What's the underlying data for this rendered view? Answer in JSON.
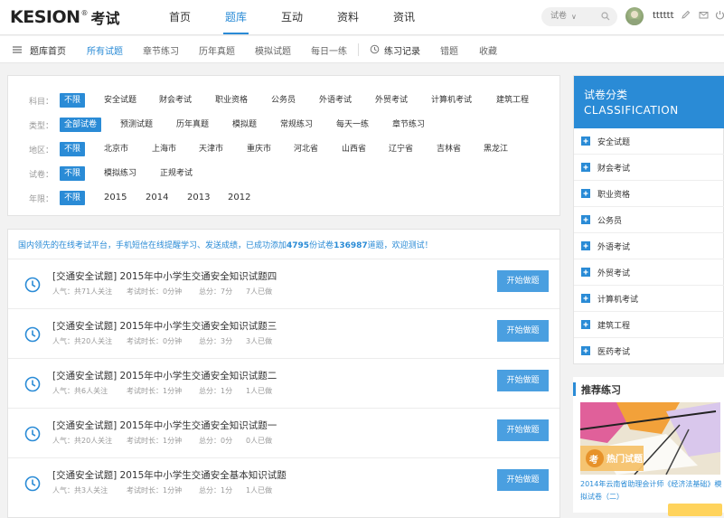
{
  "logo": {
    "en": "KESION",
    "reg": "®",
    "cn": "考试"
  },
  "nav": [
    "首页",
    "题库",
    "互动",
    "资料",
    "资讯"
  ],
  "nav_active": "题库",
  "search": {
    "label": "试卷",
    "arrow": "∨"
  },
  "user": {
    "name": "tttttt"
  },
  "subnav": {
    "home": "题库首页",
    "items": [
      "所有试题",
      "章节练习",
      "历年真题",
      "模拟试题",
      "每日一练"
    ],
    "practice": "练习记录",
    "wrong": "错题",
    "fav": "收藏"
  },
  "filters": {
    "subject": {
      "label": "科目：",
      "options": [
        "不限",
        "安全试题",
        "财会考试",
        "职业资格",
        "公务员",
        "外语考试",
        "外贸考试",
        "计算机考试",
        "建筑工程"
      ]
    },
    "type": {
      "label": "类型：",
      "options": [
        "全部试卷",
        "预测试题",
        "历年真题",
        "模拟题",
        "常规练习",
        "每天一练",
        "章节练习"
      ]
    },
    "region": {
      "label": "地区：",
      "options": [
        "不限",
        "北京市",
        "上海市",
        "天津市",
        "重庆市",
        "河北省",
        "山西省",
        "辽宁省",
        "吉林省",
        "黑龙江"
      ]
    },
    "paper": {
      "label": "试卷：",
      "options": [
        "不限",
        "模拟练习",
        "正规考试"
      ]
    },
    "year": {
      "label": "年限：",
      "options": [
        "不限",
        "2015",
        "2014",
        "2013",
        "2012"
      ]
    }
  },
  "notice": {
    "pre": "国内领先的在线考试平台，手机短信在线提醒学习、发送成绩，已成功添加",
    "papers": "4795",
    "mid": "份试卷",
    "questions": "136987",
    "post": "道题，欢迎测试！"
  },
  "exams": [
    {
      "title": "[交通安全试题] 2015年中小学生交通安全知识试题四",
      "popularity": "人气：共71人关注",
      "duration": "考试时长：0分钟",
      "score": "总分：7分",
      "done": "7人已做",
      "button": "开始做题"
    },
    {
      "title": "[交通安全试题] 2015年中小学生交通安全知识试题三",
      "popularity": "人气：共20人关注",
      "duration": "考试时长：0分钟",
      "score": "总分：3分",
      "done": "3人已做",
      "button": "开始做题"
    },
    {
      "title": "[交通安全试题] 2015年中小学生交通安全知识试题二",
      "popularity": "人气：共6人关注",
      "duration": "考试时长：1分钟",
      "score": "总分：1分",
      "done": "1人已做",
      "button": "开始做题"
    },
    {
      "title": "[交通安全试题] 2015年中小学生交通安全知识试题一",
      "popularity": "人气：共20人关注",
      "duration": "考试时长：1分钟",
      "score": "总分：0分",
      "done": "0人已做",
      "button": "开始做题"
    },
    {
      "title": "[交通安全试题] 2015年中小学生交通安全基本知识试题",
      "popularity": "人气：共3人关注",
      "duration": "考试时长：1分钟",
      "score": "总分：1分",
      "done": "1人已做",
      "button": "开始做题"
    }
  ],
  "categories": {
    "title_cn": "试卷分类",
    "title_en": "CLASSIFICATION",
    "items": [
      "安全试题",
      "财会考试",
      "职业资格",
      "公务员",
      "外语考试",
      "外贸考试",
      "计算机考试",
      "建筑工程",
      "医药考试"
    ]
  },
  "recommend": {
    "title": "推荐练习",
    "badge": "热门试题",
    "badge_icon": "考",
    "text": "2014年云南省助理会计师《经济法基础》模拟试卷（二）"
  },
  "colors": {
    "accent": "#2a8bd6",
    "button": "#4a9fe0"
  }
}
